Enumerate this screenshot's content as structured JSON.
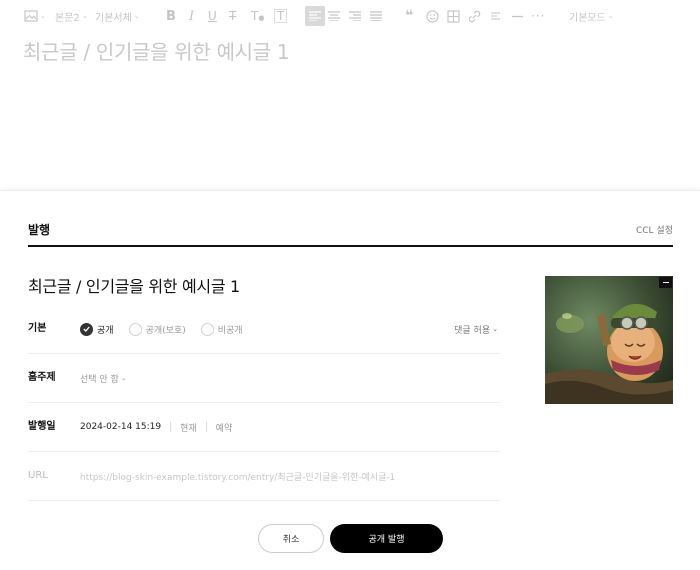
{
  "editor": {
    "toolbar": {
      "image_icon": "image-icon",
      "paragraph_style": "본문2",
      "font": "기본서체",
      "mode": "기본모드"
    },
    "title": "최근글 / 인기글을 위한 예시글 1"
  },
  "publish": {
    "header": "발행",
    "ccl": "CCL 설정",
    "post_title": "최근글 / 인기글을 위한 예시글 1",
    "basic": {
      "label": "기본",
      "options": [
        "공개",
        "공개(보호)",
        "비공개"
      ],
      "selected": "공개",
      "comment": "댓글 허용"
    },
    "category": {
      "label": "홈주제",
      "value": "선택 안 함"
    },
    "date": {
      "label": "발행일",
      "value": "2024-02-14 15:19",
      "now": "현재",
      "reserve": "예약"
    },
    "url": {
      "label": "URL",
      "value": "https://blog-skin-example.tistory.com/entry/최근글-인기글을-위한-예시글-1"
    },
    "buttons": {
      "cancel": "취소",
      "publish": "공개 발행"
    }
  }
}
